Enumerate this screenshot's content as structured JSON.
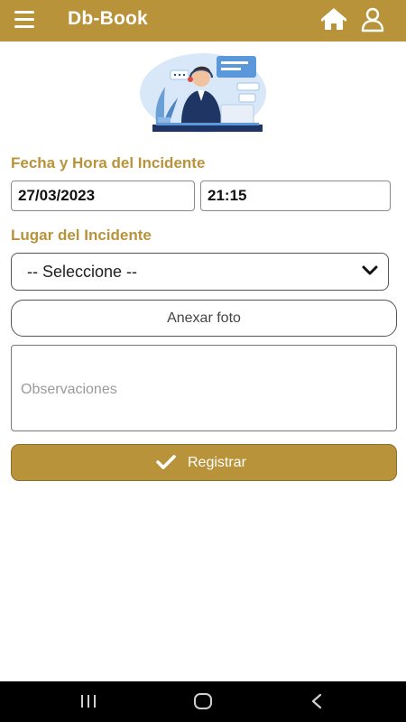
{
  "appbar": {
    "title": "Db-Book",
    "icons": {
      "menu": "menu-icon",
      "home": "home-icon",
      "user": "user-icon"
    }
  },
  "illustration": {
    "name": "support-agent-illustration"
  },
  "form": {
    "datetime_label": "Fecha y Hora del Incidente",
    "date_value": "27/03/2023",
    "time_value": "21:15",
    "place_label": "Lugar del Incidente",
    "place_selected": "-- Seleccione --",
    "attach_label": "Anexar foto",
    "observations_placeholder": "Observaciones",
    "submit_label": "Registrar"
  },
  "system_nav": {
    "items": [
      "recent-apps-icon",
      "home-nav-icon",
      "back-icon"
    ]
  },
  "colors": {
    "primary": "#b9933a",
    "nav_bg": "#000000"
  }
}
